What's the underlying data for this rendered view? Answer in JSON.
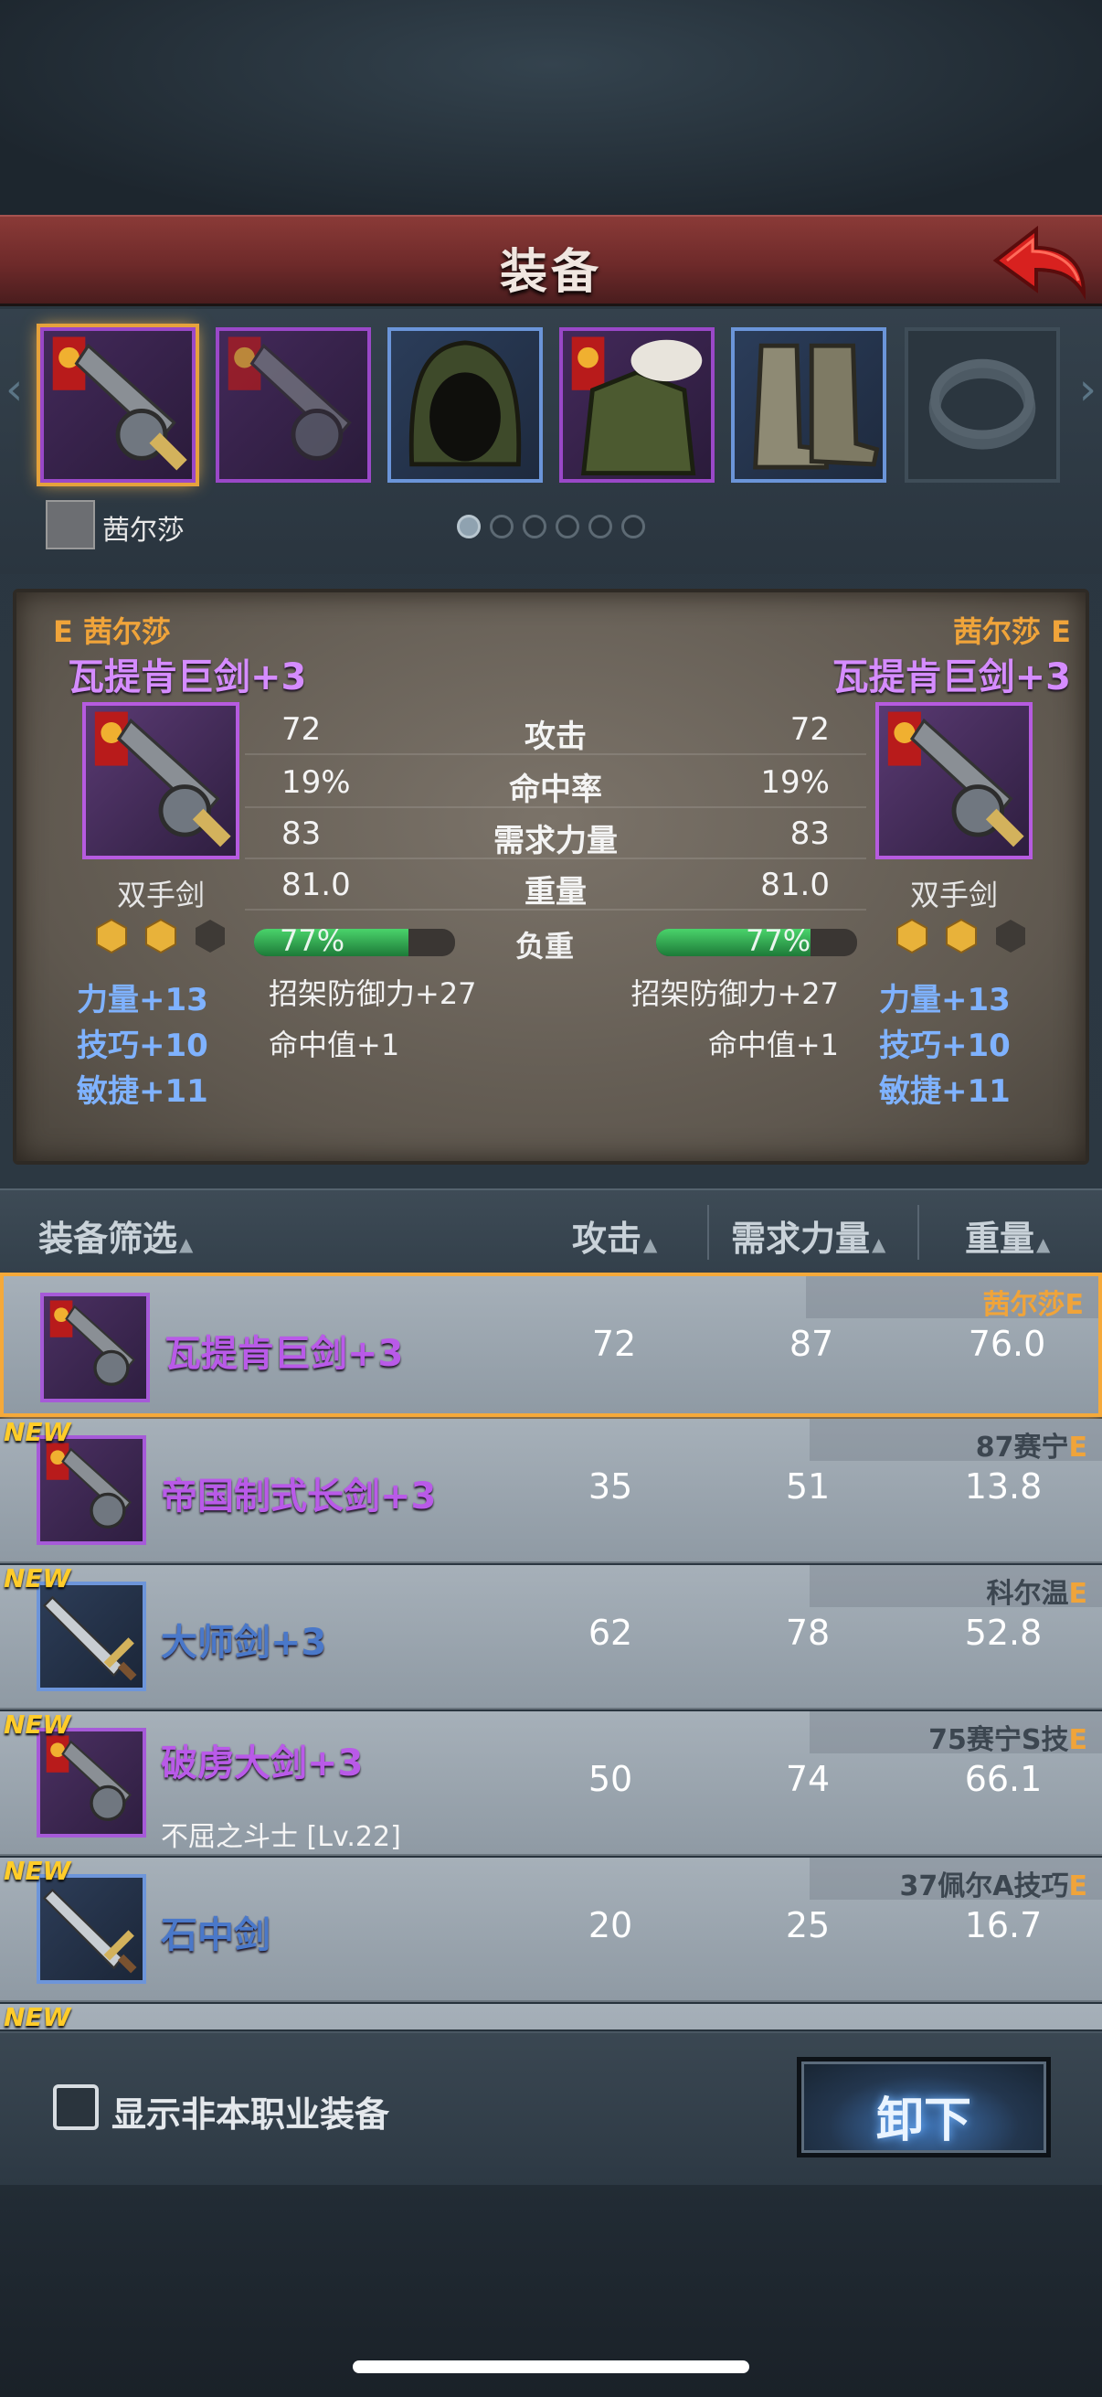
{
  "header": {
    "title": "装备"
  },
  "slots": {
    "owner_name": "茜尔莎",
    "page_dots": 6,
    "active_dot": 0,
    "items": [
      {
        "icon": "greatsword-icon",
        "rarity": "purple",
        "selected": true
      },
      {
        "icon": "greatsword-icon",
        "rarity": "purple",
        "selected": false
      },
      {
        "icon": "hood-icon",
        "rarity": "blue",
        "selected": false
      },
      {
        "icon": "fur-armor-icon",
        "rarity": "purple",
        "selected": false
      },
      {
        "icon": "boots-icon",
        "rarity": "blue",
        "selected": false
      },
      {
        "icon": "ring-icon",
        "rarity": "empty",
        "selected": false
      }
    ]
  },
  "compare": {
    "left": {
      "owner": "E 茜尔莎",
      "name": "瓦提肯巨剑+3",
      "type": "双手剑",
      "load": "77%",
      "load_fraction": 0.77,
      "attrs": [
        "力量+13",
        "技巧+10",
        "敏捷+11"
      ],
      "subs": [
        "招架防御力+27",
        "命中值+1"
      ]
    },
    "right": {
      "owner": "茜尔莎 E",
      "name": "瓦提肯巨剑+3",
      "type": "双手剑",
      "load": "77%",
      "load_fraction": 0.77,
      "attrs": [
        "力量+13",
        "技巧+10",
        "敏捷+11"
      ],
      "subs": [
        "招架防御力+27",
        "命中值+1"
      ]
    },
    "stats": [
      {
        "label": "攻击",
        "left": "72",
        "right": "72"
      },
      {
        "label": "命中率",
        "left": "19%",
        "right": "19%"
      },
      {
        "label": "需求力量",
        "left": "83",
        "right": "83"
      },
      {
        "label": "重量",
        "left": "81.0",
        "right": "81.0"
      }
    ],
    "load_label": "负重"
  },
  "list_header": {
    "filter": "装备筛选",
    "attack": "攻击",
    "str_req": "需求力量",
    "weight": "重量",
    "sort_glyph": "▲"
  },
  "items": [
    {
      "new": false,
      "name": "瓦提肯巨剑+3",
      "rarity": "purple",
      "owner": "茜尔莎",
      "grade": "E",
      "attack": "72",
      "str": "87",
      "weight": "76.0",
      "selected": true,
      "sub": ""
    },
    {
      "new": true,
      "name": "帝国制式长剑+3",
      "rarity": "purple",
      "owner": "87赛宁",
      "grade": "E",
      "attack": "35",
      "str": "51",
      "weight": "13.8",
      "selected": false,
      "sub": ""
    },
    {
      "new": true,
      "name": "大师剑+3",
      "rarity": "blue",
      "owner": "科尔温",
      "grade": "E",
      "attack": "62",
      "str": "78",
      "weight": "52.8",
      "selected": false,
      "sub": ""
    },
    {
      "new": true,
      "name": "破虏大剑+3",
      "rarity": "purple",
      "owner": "75赛宁S技",
      "grade": "E",
      "attack": "50",
      "str": "74",
      "weight": "66.1",
      "selected": false,
      "sub": "不屈之斗士 [Lv.22]"
    },
    {
      "new": true,
      "name": "石中剑",
      "rarity": "blue",
      "owner": "37佩尔A技巧",
      "grade": "E",
      "attack": "20",
      "str": "25",
      "weight": "16.7",
      "selected": false,
      "sub": ""
    }
  ],
  "new_label": "NEW",
  "bottom": {
    "show_non_class": "显示非本职业装备",
    "unequip": "卸下"
  }
}
